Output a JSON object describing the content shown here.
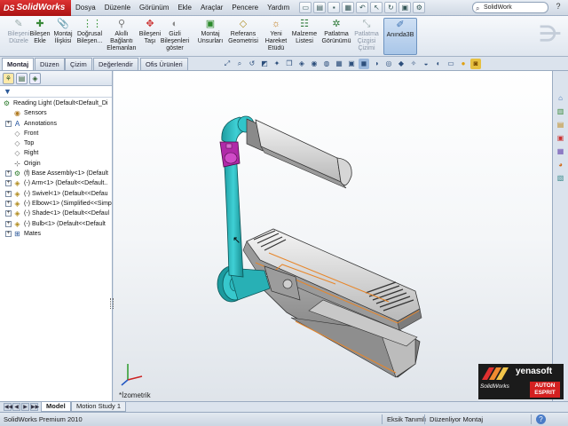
{
  "app": {
    "logo": "SolidWorks",
    "logo_mark": "DS"
  },
  "menu": [
    "Dosya",
    "Düzenle",
    "Görünüm",
    "Ekle",
    "Araçlar",
    "Pencere",
    "Yardım"
  ],
  "search": {
    "value": "SolidWork"
  },
  "command_manager": [
    {
      "label": "Bileşeni Düzele",
      "icon": "edit-component-icon",
      "disabled": true
    },
    {
      "label": "Bileşen Ekle",
      "icon": "insert-component-icon",
      "disabled": false
    },
    {
      "label": "Montaj İlişkisi",
      "icon": "mate-icon",
      "disabled": false
    },
    {
      "label": "Doğrusal Bileşen...",
      "icon": "linear-pattern-icon",
      "disabled": false
    },
    {
      "label": "Akıllı Bağlantı Elemanları",
      "icon": "smart-fasteners-icon",
      "disabled": false
    },
    {
      "label": "Bileşeni Taşı",
      "icon": "move-component-icon",
      "disabled": false
    },
    {
      "label": "Gizli Bileşenleri göster",
      "icon": "show-hidden-icon",
      "disabled": false
    },
    {
      "label": "Montaj Unsurları",
      "icon": "assembly-features-icon",
      "disabled": false
    },
    {
      "label": "Referans Geometrisi",
      "icon": "reference-geometry-icon",
      "disabled": false
    },
    {
      "label": "Yeni Hareket Etüdü",
      "icon": "motion-study-icon",
      "disabled": false
    },
    {
      "label": "Malzeme Listesi",
      "icon": "bom-icon",
      "disabled": false
    },
    {
      "label": "Patlatma Görünümü",
      "icon": "exploded-view-icon",
      "disabled": false
    },
    {
      "label": "Patlatma Çizgisi Çizimi",
      "icon": "explode-line-icon",
      "disabled": true
    },
    {
      "label": "Anında3B",
      "icon": "instant3d-icon",
      "disabled": false,
      "active": true
    }
  ],
  "tabs": [
    "Montaj",
    "Düzen",
    "Çizim",
    "Değerlendir",
    "Ofis Ürünleri"
  ],
  "selected_tab": "Montaj",
  "tree": [
    {
      "label": "Reading Light  (Default<Default_Di",
      "icon": "assembly-icon",
      "expander": "",
      "level": 0
    },
    {
      "label": "Sensors",
      "icon": "sensors-icon",
      "expander": "",
      "level": 1
    },
    {
      "label": "Annotations",
      "icon": "annotations-icon",
      "expander": "+",
      "level": 1
    },
    {
      "label": "Front",
      "icon": "plane-icon",
      "expander": "",
      "level": 1
    },
    {
      "label": "Top",
      "icon": "plane-icon",
      "expander": "",
      "level": 1
    },
    {
      "label": "Right",
      "icon": "plane-icon",
      "expander": "",
      "level": 1
    },
    {
      "label": "Origin",
      "icon": "origin-icon",
      "expander": "",
      "level": 1
    },
    {
      "label": "(f) Base Assembly<1> (Default",
      "icon": "subassembly-icon",
      "expander": "+",
      "level": 1
    },
    {
      "label": "(-) Arm<1> (Default<<Default..",
      "icon": "part-icon",
      "expander": "+",
      "level": 1
    },
    {
      "label": "(-) Swivel<1> (Default<<Defau",
      "icon": "part-icon",
      "expander": "+",
      "level": 1
    },
    {
      "label": "(-) Elbow<1> (Simplified<<Simp",
      "icon": "part-icon",
      "expander": "+",
      "level": 1
    },
    {
      "label": "(-) Shade<1> (Default<<Defaul",
      "icon": "part-icon",
      "expander": "+",
      "level": 1
    },
    {
      "label": "(-) Bulb<1> (Default<<Default",
      "icon": "part-icon",
      "expander": "+",
      "level": 1
    },
    {
      "label": "Mates",
      "icon": "mates-icon",
      "expander": "+",
      "level": 1
    }
  ],
  "viewport": {
    "view_label": "*İzometrik"
  },
  "bottom_tabs": [
    "Model",
    "Motion Study 1"
  ],
  "selected_bottom_tab": "Model",
  "status": {
    "left": "SolidWorks Premium 2010",
    "mid": "Eksik Tanımlı",
    "right": "Düzenliyor Montaj",
    "help": "?"
  },
  "brand": {
    "name": "yenasoft",
    "partner": "AUTON ESPRIT",
    "sub": "SolidWorks"
  },
  "colors": {
    "arm": "#22b3b8",
    "swivel": "#b02aa8",
    "body": "#d8d8d8",
    "selection": "#e7862a",
    "logo": "#c62020"
  }
}
